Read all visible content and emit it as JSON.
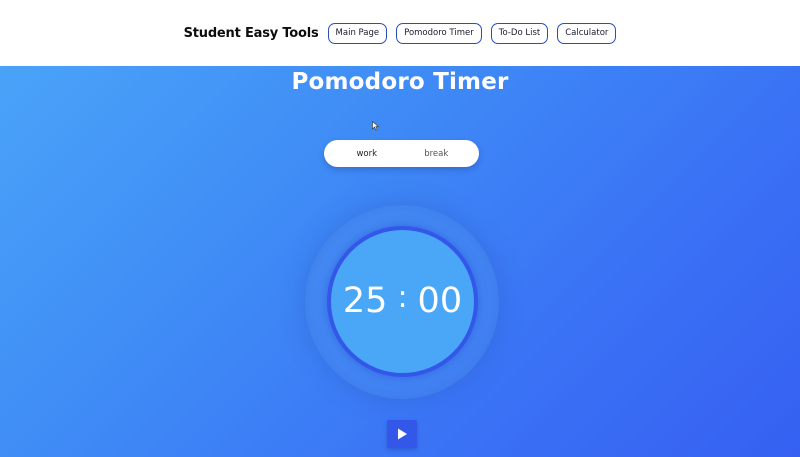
{
  "nav": {
    "brand": "Student Easy Tools",
    "links": [
      "Main Page",
      "Pomodoro Timer",
      "To-Do List",
      "Calculator"
    ]
  },
  "page": {
    "title": "Pomodoro Timer"
  },
  "mode_toggle": {
    "options": [
      "work",
      "break"
    ],
    "selected": "work"
  },
  "timer": {
    "minutes": "25",
    "separator": ":",
    "seconds": "00"
  },
  "controls": {
    "play_icon": "play-icon"
  },
  "colors": {
    "accent": "#3357e8",
    "gradient_start": "#4aa3f8",
    "gradient_end": "#3660f2",
    "nav_border": "#2a4fb7"
  }
}
